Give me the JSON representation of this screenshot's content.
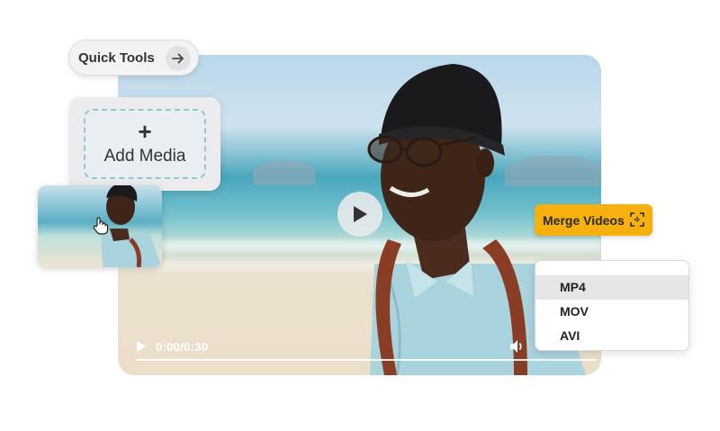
{
  "player": {
    "time": "0:00/0:30",
    "center_play_icon": "play-icon",
    "volume_icon": "volume-icon"
  },
  "quick_tools": {
    "label": "Quick Tools",
    "icon": "arrow-right-icon"
  },
  "add_media": {
    "plus": "+",
    "label": "Add Media"
  },
  "merge": {
    "label": "Merge Videos",
    "icon": "merge-icon",
    "color": "#f6b10f"
  },
  "formats": {
    "items": [
      "MP4",
      "MOV",
      "AVI"
    ],
    "selected": "MP4"
  }
}
